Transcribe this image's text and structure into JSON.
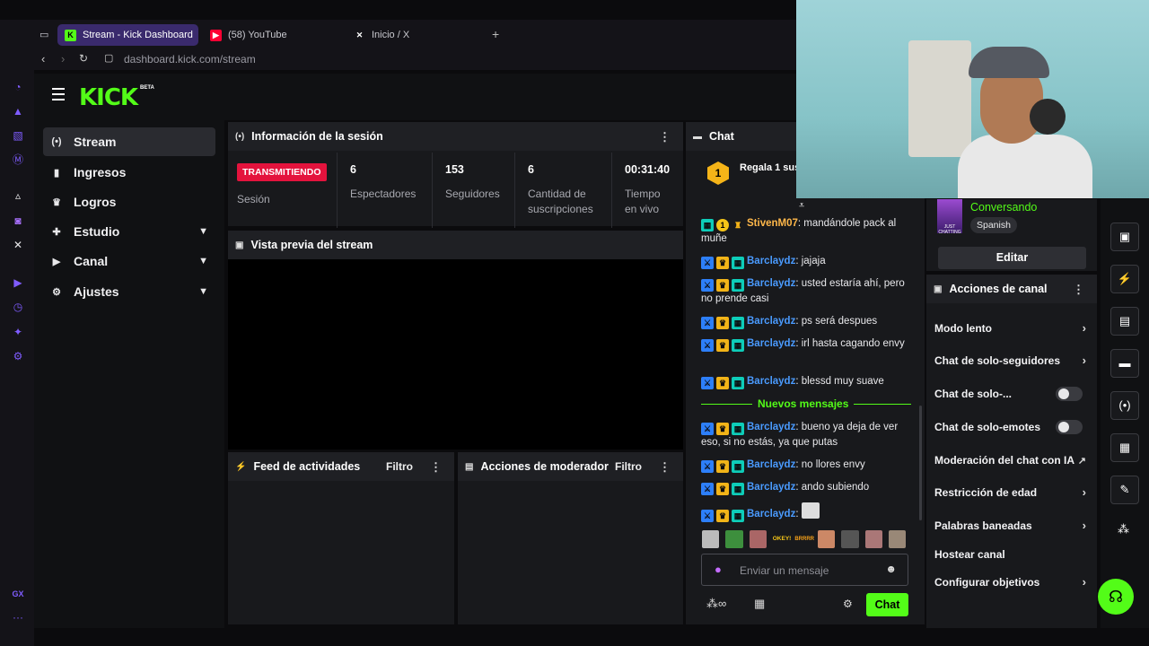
{
  "browser": {
    "tabs": [
      {
        "label": "Stream - Kick Dashboard",
        "active": true
      },
      {
        "label": "(58) YouTube",
        "active": false
      },
      {
        "label": "Inicio / X",
        "active": false
      }
    ],
    "new_tab": "+",
    "url": "dashboard.kick.com/stream",
    "gx_label": "GX",
    "more": "···"
  },
  "brand": {
    "logo": "KICK",
    "beta": "BETA",
    "accent": "#53fc18"
  },
  "sidebar": {
    "items": [
      {
        "label": "Stream",
        "icon": "broadcast-icon",
        "active": true
      },
      {
        "label": "Ingresos",
        "icon": "chart-icon"
      },
      {
        "label": "Logros",
        "icon": "trophy-icon"
      },
      {
        "label": "Estudio",
        "icon": "studio-icon",
        "expandable": true
      },
      {
        "label": "Canal",
        "icon": "channel-icon",
        "expandable": true
      },
      {
        "label": "Ajustes",
        "icon": "gear-icon",
        "expandable": true
      }
    ]
  },
  "session": {
    "title": "Información de la sesión",
    "status": "TRANSMITIENDO",
    "status_label": "Sesión",
    "stats": [
      {
        "value": "6",
        "label": "Espectadores"
      },
      {
        "value": "153",
        "label": "Seguidores"
      },
      {
        "value": "6",
        "label": "Cantidad de suscripciones"
      },
      {
        "value": "00:31:40",
        "label": "Tiempo en vivo"
      }
    ]
  },
  "preview": {
    "title": "Vista previa del stream"
  },
  "activity": {
    "title": "Feed de actividades",
    "filter": "Filtro"
  },
  "moderator": {
    "title": "Acciones de moderador",
    "filter": "Filtro"
  },
  "chat": {
    "title": "Chat",
    "pinned_count": "1",
    "pinned_text": "Regala 1 sus",
    "new_messages": "Nuevos mensajes",
    "placeholder": "Enviar un mensaje",
    "send": "Chat",
    "messages": [
      {
        "user": "StivenM07",
        "text": "mandándole pack al muñe",
        "style": "user2"
      },
      {
        "user": "Barclaydz",
        "text": "jajaja"
      },
      {
        "user": "Barclaydz",
        "text": "usted estaría ahí, pero no prende casi"
      },
      {
        "user": "Barclaydz",
        "text": "ps será despues"
      },
      {
        "user": "Barclaydz",
        "text": "irl hasta cagando envy"
      },
      {
        "user": "Barclaydz",
        "text": "blessd muy suave"
      },
      {
        "user": "Barclaydz",
        "text": "bueno ya deja de ver eso, si no estás, ya que putas"
      },
      {
        "user": "Barclaydz",
        "text": "no llores envy"
      },
      {
        "user": "Barclaydz",
        "text": "ando subiendo"
      },
      {
        "user": "Barclaydz",
        "text": ""
      }
    ],
    "emotes": [
      "OKEY!",
      "BRRRR"
    ]
  },
  "stream_info": {
    "category": "Conversando",
    "language": "Spanish",
    "category_thumb": "JUST CHATTING",
    "edit": "Editar"
  },
  "channel_actions": {
    "title": "Acciones de canal",
    "items": [
      {
        "label": "Modo lento",
        "control": "arrow"
      },
      {
        "label": "Chat de solo-seguidores",
        "control": "arrow"
      },
      {
        "label": "Chat de solo-...",
        "control": "toggle"
      },
      {
        "label": "Chat de solo-emotes",
        "control": "toggle"
      },
      {
        "label": "Moderación del chat con IA",
        "control": "external"
      },
      {
        "label": "Restricción de edad",
        "control": "arrow"
      },
      {
        "label": "Palabras baneadas",
        "control": "arrow"
      },
      {
        "label": "Hostear canal",
        "control": "none"
      },
      {
        "label": "Configurar objetivos",
        "control": "arrow"
      }
    ]
  }
}
